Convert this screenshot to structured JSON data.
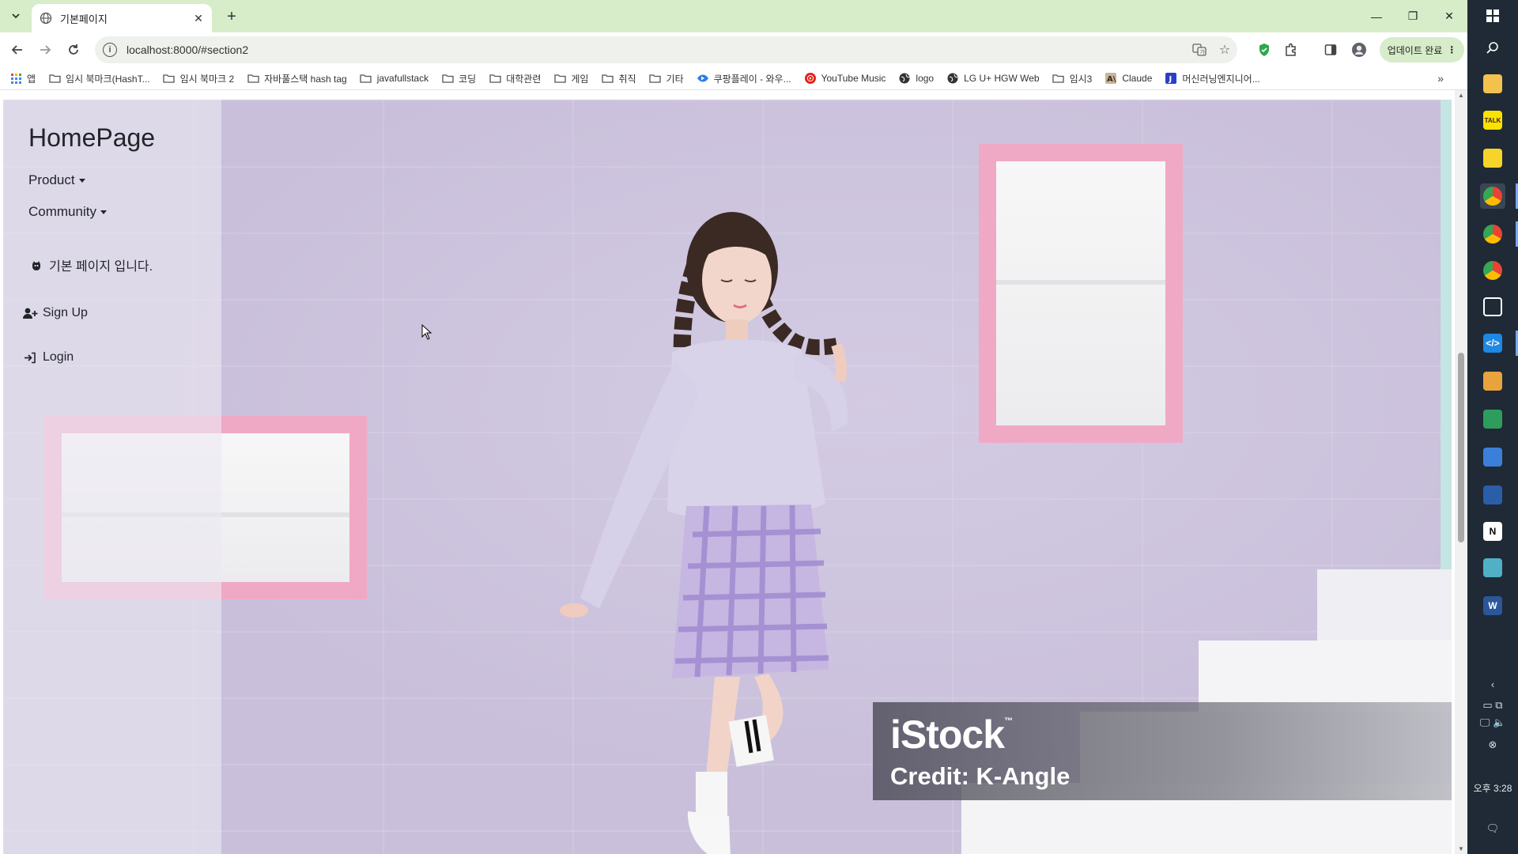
{
  "browser": {
    "tab_title": "기본페이지",
    "url": "localhost:8000/#section2",
    "update_label": "업데이트 완료",
    "bookmarks": [
      {
        "label": "앱",
        "icon": "apps-grid-icon"
      },
      {
        "label": "임시 북마크(HashT...",
        "icon": "folder-icon"
      },
      {
        "label": "임시 북마크 2",
        "icon": "folder-icon"
      },
      {
        "label": "자바풀스택 hash tag",
        "icon": "folder-icon"
      },
      {
        "label": "javafullstack",
        "icon": "folder-icon"
      },
      {
        "label": "코딩",
        "icon": "folder-icon"
      },
      {
        "label": "대학관련",
        "icon": "folder-icon"
      },
      {
        "label": "게임",
        "icon": "folder-icon"
      },
      {
        "label": "취직",
        "icon": "folder-icon"
      },
      {
        "label": "기타",
        "icon": "folder-icon"
      },
      {
        "label": "쿠팡플레이 - 와우...",
        "icon": "coupang-play-icon"
      },
      {
        "label": "YouTube Music",
        "icon": "youtube-music-icon"
      },
      {
        "label": "logo",
        "icon": "globe-icon"
      },
      {
        "label": "LG U+ HGW Web",
        "icon": "globe-icon"
      },
      {
        "label": "임시3",
        "icon": "folder-icon"
      },
      {
        "label": "Claude",
        "icon": "claude-icon"
      },
      {
        "label": "머신러닝엔지니어...",
        "icon": "j-icon"
      }
    ]
  },
  "page": {
    "brand": "HomePage",
    "nav": {
      "product": "Product",
      "community": "Community"
    },
    "message": "기본 페이지 입니다.",
    "signup": "Sign Up",
    "login": "Login",
    "watermark": {
      "brand": "iStock",
      "trademark": "™",
      "credit": "Credit: K-Angle"
    }
  },
  "colors": {
    "tab_strip": "#d7ecc9",
    "wall": "#c9bfdb",
    "niche_frame": "#f0a9c4",
    "taskbar": "#1f2a36"
  },
  "taskbar": {
    "time": "오후 3:28"
  }
}
